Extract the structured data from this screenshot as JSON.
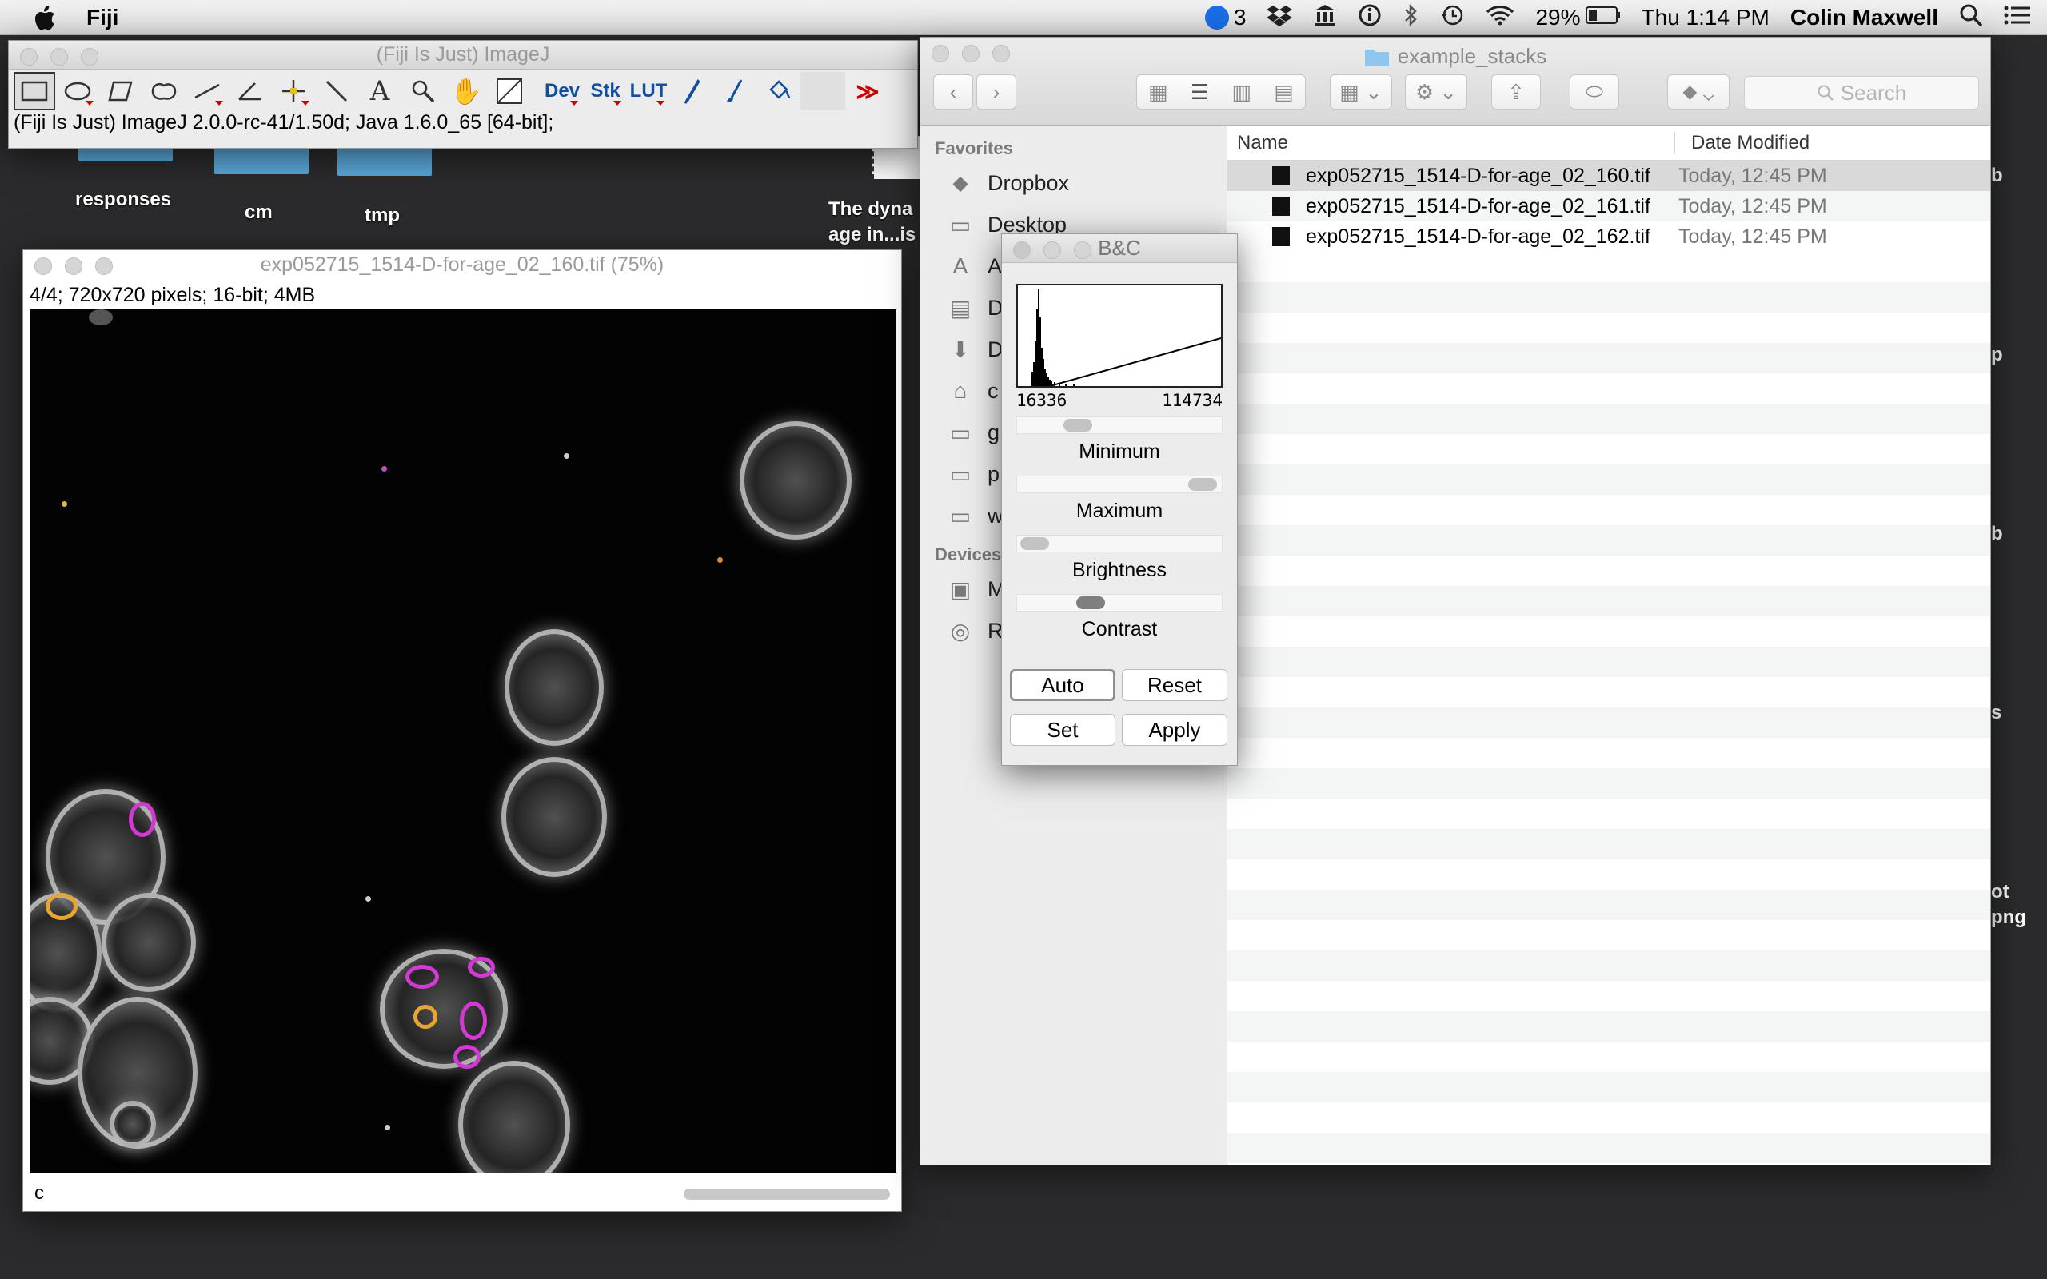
{
  "menubar": {
    "app_name": "Fiji",
    "notification_count": "3",
    "battery": "29%",
    "clock": "Thu 1:14 PM",
    "user": "Colin Maxwell"
  },
  "desktop": {
    "folders": [
      "responses",
      "cm",
      "tmp"
    ],
    "caption_line1": "The dyna",
    "caption_line2": "age in...is",
    "right_edge": [
      "b",
      "p",
      "b",
      "s",
      "ot",
      "png"
    ]
  },
  "imagej": {
    "title": "(Fiji Is Just) ImageJ",
    "tool_dev": "Dev",
    "tool_stk": "Stk",
    "tool_lut": "LUT",
    "more": "≫",
    "status": "(Fiji Is Just) ImageJ 2.0.0-rc-41/1.50d; Java 1.6.0_65 [64-bit];"
  },
  "image_window": {
    "title": "exp052715_1514-D-for-age_02_160.tif (75%)",
    "info": "4/4; 720x720 pixels; 16-bit; 4MB",
    "channel": "c"
  },
  "finder": {
    "title": "example_stacks",
    "search_placeholder": "Search",
    "sidebar": {
      "favorites_label": "Favorites",
      "favorites": [
        "Dropbox",
        "Desktop",
        "A",
        "D",
        "D",
        "c",
        "g",
        "p",
        "w"
      ],
      "devices_label": "Devices",
      "devices": [
        "M",
        "R"
      ]
    },
    "columns": {
      "name": "Name",
      "date": "Date Modified"
    },
    "files": [
      {
        "name": "exp052715_1514-D-for-age_02_160.tif",
        "date": "Today, 12:45 PM"
      },
      {
        "name": "exp052715_1514-D-for-age_02_161.tif",
        "date": "Today, 12:45 PM"
      },
      {
        "name": "exp052715_1514-D-for-age_02_162.tif",
        "date": "Today, 12:45 PM"
      }
    ]
  },
  "bc": {
    "title": "B&C",
    "range_min": "16336",
    "range_max": "114734",
    "minimum_label": "Minimum",
    "maximum_label": "Maximum",
    "brightness_label": "Brightness",
    "contrast_label": "Contrast",
    "auto": "Auto",
    "reset": "Reset",
    "set": "Set",
    "apply": "Apply"
  }
}
